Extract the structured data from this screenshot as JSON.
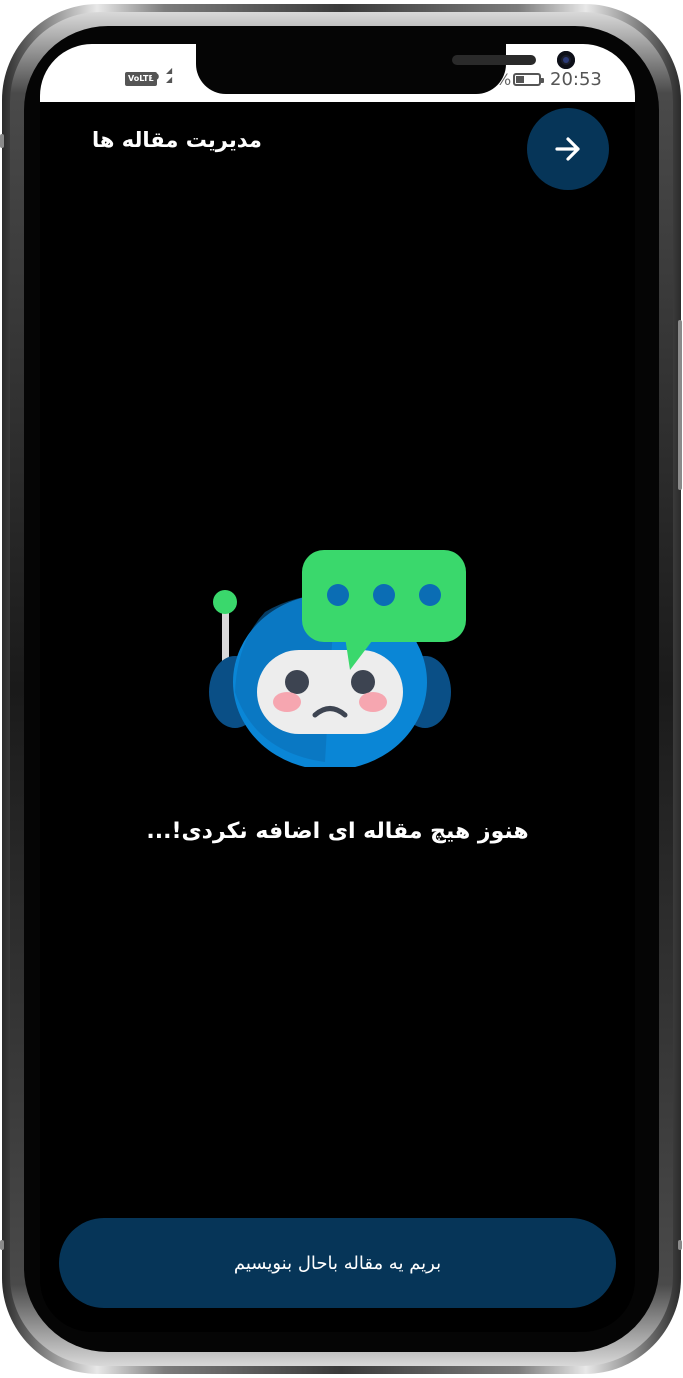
{
  "status_bar": {
    "network_badge": "VoLTE",
    "network_suffix": "D",
    "battery_percent_sign": "%",
    "time": "20:53"
  },
  "header": {
    "title": "مدیریت مقاله ها",
    "back_icon": "arrow-right-icon"
  },
  "empty_state": {
    "illustration": "sad-robot-chat-icon",
    "message": "هنوز هیچ مقاله ای اضافه نکردی!..."
  },
  "cta": {
    "label": "بریم یه مقاله باحال بنویسیم"
  },
  "colors": {
    "background": "#000000",
    "primary_button": "#063558",
    "bubble_green": "#3ad86c",
    "robot_blue": "#0a86d6"
  }
}
